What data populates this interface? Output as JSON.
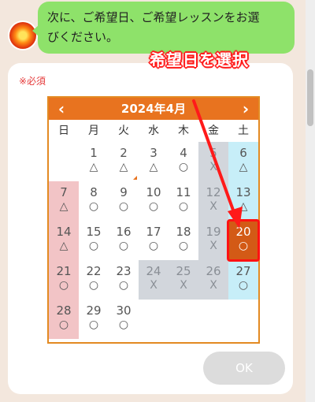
{
  "chat": {
    "message_line1": "次に、ご希望日、ご希望レッスンをお選",
    "message_line2": "びください。"
  },
  "form": {
    "required_label": "※必須",
    "ok_label": "OK"
  },
  "calendar": {
    "title": "2024年4月",
    "prev_label": "‹",
    "next_label": "›",
    "weekdays": [
      "日",
      "月",
      "火",
      "水",
      "木",
      "金",
      "土"
    ],
    "days": [
      {
        "day": "1",
        "mark": "△"
      },
      {
        "day": "2",
        "mark": "△"
      },
      {
        "day": "3",
        "mark": "△"
      },
      {
        "day": "4",
        "mark": "○"
      },
      {
        "day": "5",
        "mark": "X"
      },
      {
        "day": "6",
        "mark": "△"
      },
      {
        "day": "7",
        "mark": "△"
      },
      {
        "day": "8",
        "mark": "○"
      },
      {
        "day": "9",
        "mark": "○"
      },
      {
        "day": "10",
        "mark": "○"
      },
      {
        "day": "11",
        "mark": "○"
      },
      {
        "day": "12",
        "mark": "X"
      },
      {
        "day": "13",
        "mark": "△"
      },
      {
        "day": "14",
        "mark": "△"
      },
      {
        "day": "15",
        "mark": "○"
      },
      {
        "day": "16",
        "mark": "○"
      },
      {
        "day": "17",
        "mark": "○"
      },
      {
        "day": "18",
        "mark": "○"
      },
      {
        "day": "19",
        "mark": "X"
      },
      {
        "day": "20",
        "mark": "○"
      },
      {
        "day": "21",
        "mark": "○"
      },
      {
        "day": "22",
        "mark": "○"
      },
      {
        "day": "23",
        "mark": "○"
      },
      {
        "day": "24",
        "mark": "X"
      },
      {
        "day": "25",
        "mark": "X"
      },
      {
        "day": "26",
        "mark": "X"
      },
      {
        "day": "27",
        "mark": "○"
      },
      {
        "day": "28",
        "mark": "○"
      },
      {
        "day": "29",
        "mark": "○"
      },
      {
        "day": "30",
        "mark": "○"
      }
    ]
  },
  "annotation": {
    "text": "希望日を選択"
  },
  "colors": {
    "header": "#e8731f",
    "selected": "#d35a16",
    "highlight": "#ff1212",
    "bubble": "#8ee26a"
  }
}
